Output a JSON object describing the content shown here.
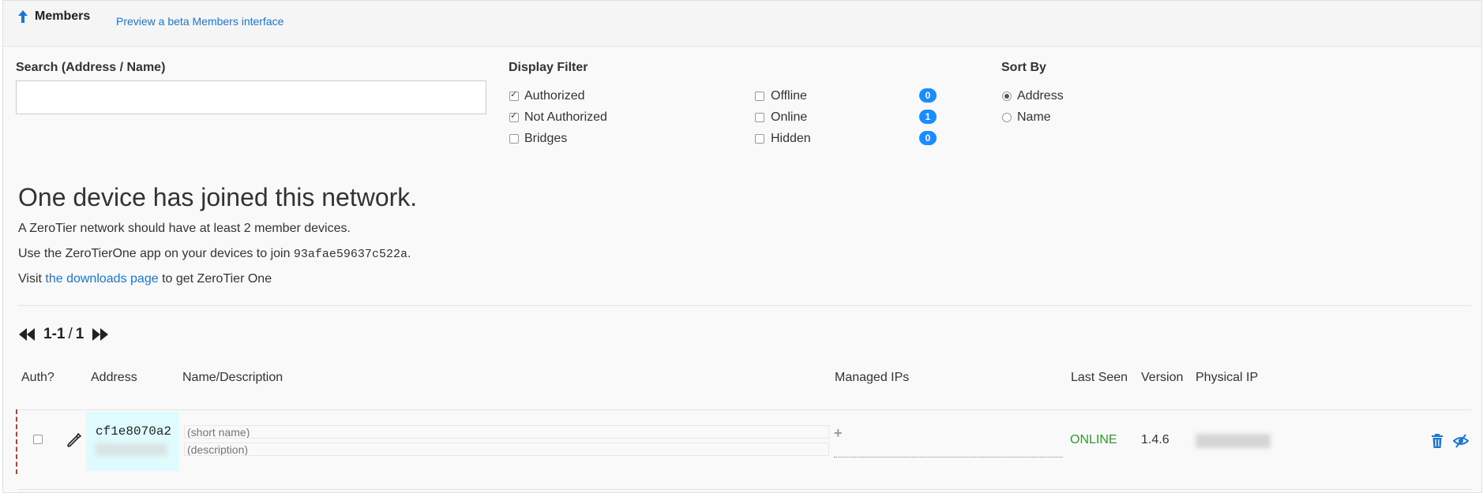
{
  "header": {
    "title": "Members",
    "beta_link": "Preview a beta Members interface"
  },
  "search": {
    "label": "Search (Address / Name)",
    "value": "",
    "placeholder": ""
  },
  "display_filter": {
    "label": "Display Filter",
    "left": [
      {
        "label": "Authorized",
        "checked": true
      },
      {
        "label": "Not Authorized",
        "checked": true
      },
      {
        "label": "Bridges",
        "checked": false
      }
    ],
    "right": [
      {
        "label": "Offline",
        "checked": false,
        "count": "0"
      },
      {
        "label": "Online",
        "checked": false,
        "count": "1"
      },
      {
        "label": "Hidden",
        "checked": false,
        "count": "0"
      }
    ]
  },
  "sort_by": {
    "label": "Sort By",
    "options": [
      {
        "label": "Address",
        "selected": true
      },
      {
        "label": "Name",
        "selected": false
      }
    ]
  },
  "notice": {
    "heading": "One device has joined this network.",
    "line1": "A ZeroTier network should have at least 2 member devices.",
    "line2_prefix": "Use the ZeroTierOne app on your devices to join ",
    "network_id": "93afae59637c522a",
    "line2_suffix": ".",
    "line3_prefix": "Visit ",
    "downloads_link": "the downloads page",
    "line3_suffix": " to get ZeroTier One"
  },
  "pagination": {
    "range": "1-1",
    "separator": "/",
    "total": "1"
  },
  "table": {
    "columns": [
      "Auth?",
      "Address",
      "Name/Description",
      "Managed IPs",
      "Last Seen",
      "Version",
      "Physical IP"
    ],
    "rows": [
      {
        "authorized": false,
        "address": "cf1e8070a2",
        "name_placeholder": "(short name)",
        "description_placeholder": "(description)",
        "managed_ip_add": "+",
        "last_seen": "ONLINE",
        "version": "1.4.6"
      }
    ]
  },
  "colors": {
    "accent": "#1a75d2",
    "badge": "#1a8cff",
    "online": "#2d9c2d",
    "address_highlight": "#e0fbfd",
    "row_marker": "#c0392b"
  }
}
